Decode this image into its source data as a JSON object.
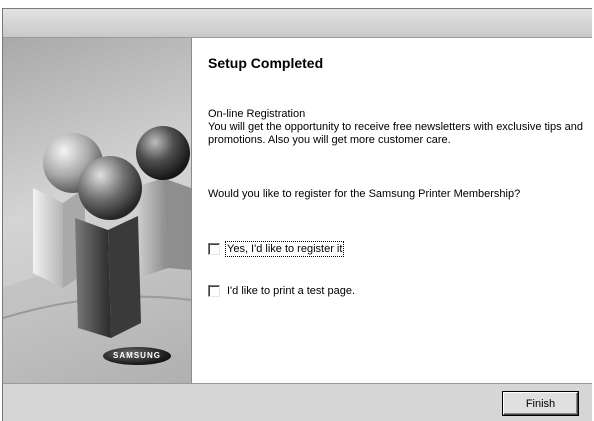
{
  "dialog": {
    "title_bar_text": "",
    "page_title": "Setup Completed",
    "registration_heading": "On-line Registration",
    "registration_text": "You will get the opportunity to receive free newsletters with exclusive tips and promotions. Also you will get more customer care.",
    "question": "Would you like to register for the Samsung Printer Membership?",
    "options": [
      {
        "label": "Yes, I'd like to register it",
        "checked": false,
        "focused": true
      },
      {
        "label": "I'd like to print a test page.",
        "checked": false,
        "focused": false
      }
    ],
    "finish_label": "Finish"
  },
  "branding": {
    "logo_text": "SAMSUNG",
    "art_icon": "spheres-and-pillars-illustration"
  }
}
